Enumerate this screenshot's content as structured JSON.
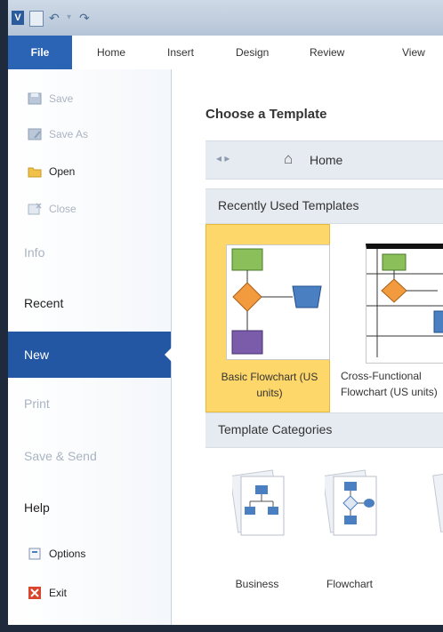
{
  "ribbon": {
    "tabs": [
      "File",
      "Home",
      "Insert",
      "Design",
      "Review",
      "View"
    ]
  },
  "backstage_nav": {
    "items": [
      {
        "label": "Save",
        "icon": "save-icon",
        "enabled": false
      },
      {
        "label": "Save As",
        "icon": "save-as-icon",
        "enabled": false
      },
      {
        "label": "Open",
        "icon": "folder-open-icon",
        "enabled": true
      },
      {
        "label": "Close",
        "icon": "close-file-icon",
        "enabled": false
      },
      {
        "label": "Info",
        "enabled": false
      },
      {
        "label": "Recent",
        "enabled": true
      },
      {
        "label": "New",
        "enabled": true,
        "selected": true
      },
      {
        "label": "Print",
        "enabled": false
      },
      {
        "label": "Save & Send",
        "enabled": false
      },
      {
        "label": "Help",
        "enabled": true
      },
      {
        "label": "Options",
        "icon": "options-icon",
        "enabled": true
      },
      {
        "label": "Exit",
        "icon": "exit-icon",
        "enabled": true
      }
    ]
  },
  "main": {
    "title": "Choose a Template",
    "breadcrumb": {
      "home_label": "Home"
    },
    "recent_section": "Recently Used Templates",
    "templates": [
      {
        "caption": "Basic Flowchart (US units)",
        "selected": true
      },
      {
        "caption": "Cross-Functional Flowchart (US units)",
        "selected": false
      }
    ],
    "categories_section": "Template Categories",
    "categories": [
      "Business",
      "Flowchart"
    ]
  },
  "colors": {
    "file_tab": "#2b63b5",
    "nav_selected": "#2356a3",
    "template_selected": "#fdd76a",
    "flow_green": "#8bbf5a",
    "flow_orange": "#f19a3e",
    "flow_blue": "#4a7fc1",
    "flow_purple": "#7a5cab"
  }
}
